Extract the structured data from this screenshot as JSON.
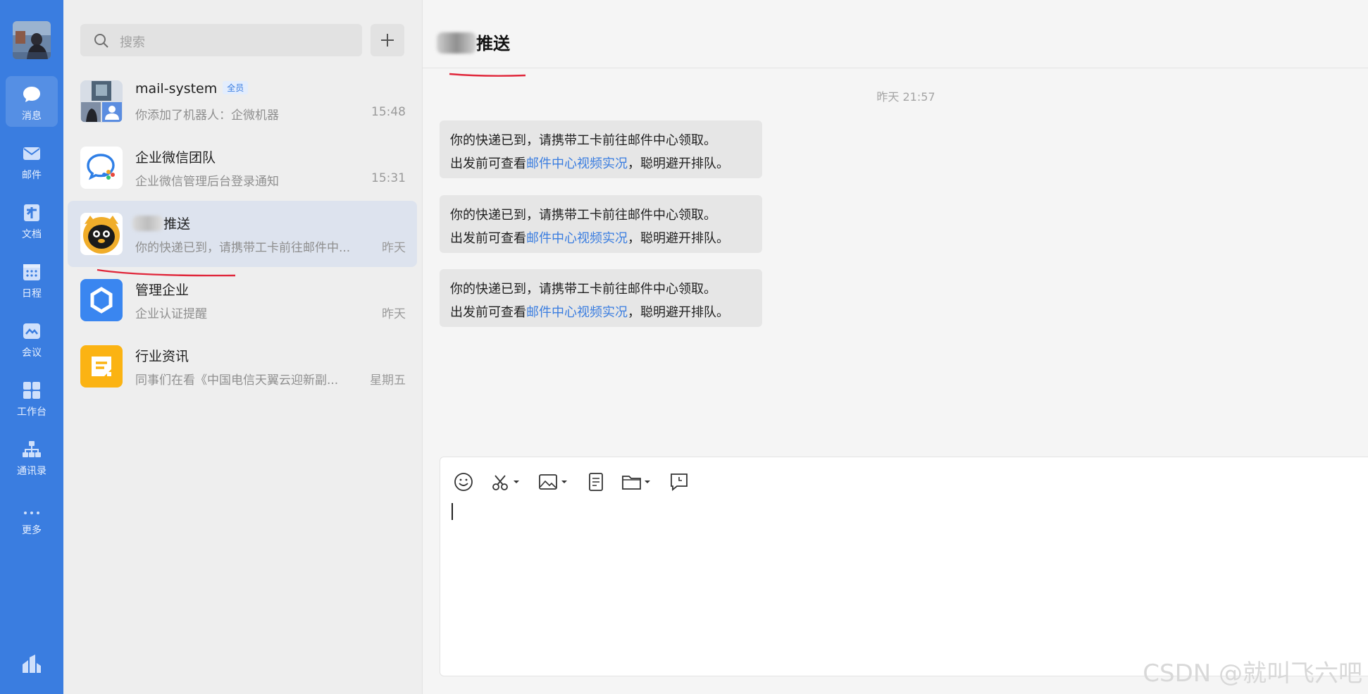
{
  "nav": {
    "items": [
      {
        "label": "消息",
        "icon": "message-icon",
        "active": true
      },
      {
        "label": "邮件",
        "icon": "mail-icon"
      },
      {
        "label": "文档",
        "icon": "document-icon"
      },
      {
        "label": "日程",
        "icon": "calendar-icon"
      },
      {
        "label": "会议",
        "icon": "meeting-icon"
      },
      {
        "label": "工作台",
        "icon": "workbench-icon"
      },
      {
        "label": "通讯录",
        "icon": "contacts-icon"
      },
      {
        "label": "更多",
        "icon": "more-icon"
      }
    ],
    "accent": "#3a7de0"
  },
  "search": {
    "placeholder": "搜索"
  },
  "add_button": {
    "label": "+"
  },
  "conversations": [
    {
      "name": "mail-system",
      "badge": "全员",
      "preview": "你添加了机器人：企微机器",
      "time": "15:48"
    },
    {
      "name": "企业微信团队",
      "preview": "企业微信管理后台登录通知",
      "time": "15:31"
    },
    {
      "name": "推送",
      "preview": "你的快递已到，请携带工卡前往邮件中...",
      "time": "昨天",
      "selected": true
    },
    {
      "name": "管理企业",
      "preview": "企业认证提醒",
      "time": "昨天"
    },
    {
      "name": "行业资讯",
      "preview": "同事们在看《中国电信天翼云迎新副...",
      "time": "星期五"
    }
  ],
  "chat": {
    "title": "推送",
    "timestamp": "昨天 21:57",
    "messages": [
      {
        "line1": "你的快递已到，请携带工卡前往邮件中心领取。",
        "line2_before": "出发前可查看",
        "link": "邮件中心视频实况",
        "line2_after": "，聪明避开排队。"
      },
      {
        "line1": "你的快递已到，请携带工卡前往邮件中心领取。",
        "line2_before": "出发前可查看",
        "link": "邮件中心视频实况",
        "line2_after": "，聪明避开排队。"
      },
      {
        "line1": "你的快递已到，请携带工卡前往邮件中心领取。",
        "line2_before": "出发前可查看",
        "link": "邮件中心视频实况",
        "line2_after": "，聪明避开排队。"
      }
    ]
  },
  "composer": {
    "tools": [
      "emoji-icon",
      "screenshot-icon",
      "image-icon",
      "note-icon",
      "folder-icon",
      "schedule-message-icon"
    ]
  },
  "watermark": "CSDN @就叫飞六吧"
}
